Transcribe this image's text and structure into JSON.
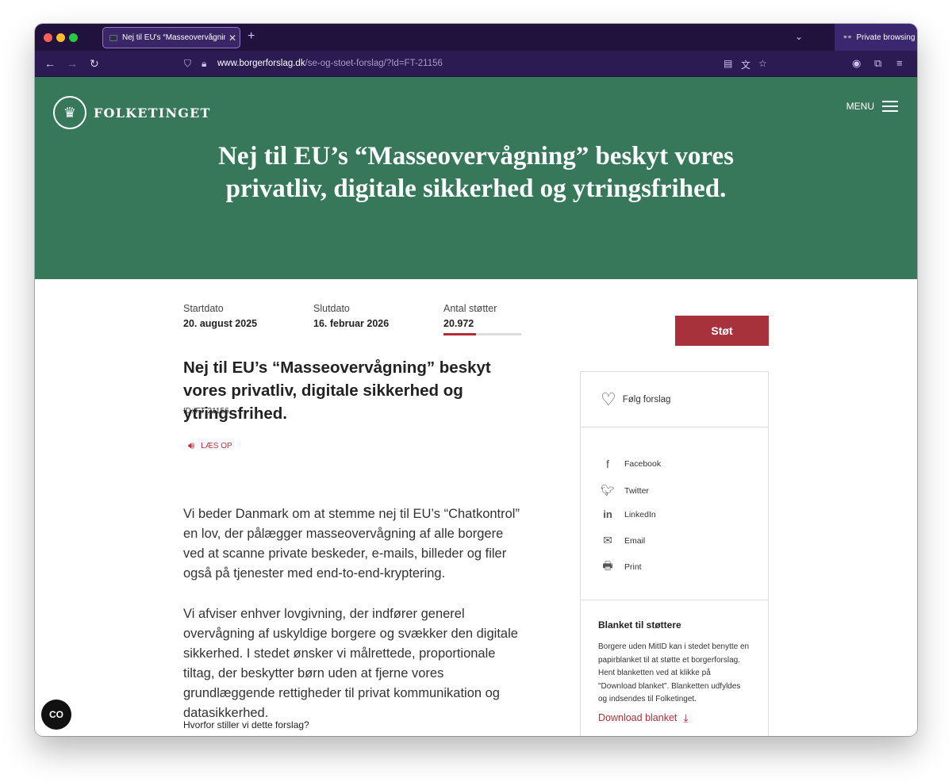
{
  "browser": {
    "tab_title": "Nej til EU's “Masseovervågning” beskyt vores privatliv",
    "tab_close": "✕",
    "new_tab": "+",
    "private_label": "Private browsing",
    "url_host": "www.borgerforslag.dk",
    "url_path": "/se-og-stoet-forslag/?Id=FT-21156"
  },
  "site": {
    "logo_text": "FOLKETINGET",
    "menu_label": "MENU"
  },
  "hero": {
    "title": "Nej til EU’s “Masseovervågning” beskyt vores privatliv, digitale sikkerhed og ytringsfrihed."
  },
  "meta": {
    "start_label": "Startdato",
    "start_value": "20. august 2025",
    "end_label": "Slutdato",
    "end_value": "16. februar 2026",
    "support_label": "Antal støtter",
    "support_value": "20.972",
    "support_progress": 0.42
  },
  "support_button": "Støt",
  "article": {
    "title": "Nej til EU’s “Masseovervågning” beskyt vores privatliv, digitale sikkerhed og ytringsfrihed.",
    "id": "ID: FT-21156",
    "read_aloud": "LÆS OP",
    "paragraph1": "Vi beder Danmark om at stemme nej til EU’s “Chatkontrol” en lov, der pålægger masseovervågning af alle borgere ved at scanne private beskeder, e-mails, billeder og filer også på tjenester med end-to-end-kryptering.",
    "paragraph2": "Vi afviser enhver lovgivning, der indfører generel overvågning af uskyldige borgere og svækker den digitale sikkerhed. I stedet ønsker vi målrettede, proportionale tiltag, der beskytter børn uden at fjerne vores grundlæggende rettigheder til privat kommunikation og datasikkerhed.",
    "why_heading": "Hvorfor stiller vi dette forslag?"
  },
  "sidebar": {
    "follow": "Følg forslag",
    "share": [
      {
        "label": "Facebook",
        "icon": "facebook-icon"
      },
      {
        "label": "Twitter",
        "icon": "twitter-icon"
      },
      {
        "label": "LinkedIn",
        "icon": "linkedin-icon"
      },
      {
        "label": "Email",
        "icon": "email-icon"
      },
      {
        "label": "Print",
        "icon": "print-icon"
      }
    ],
    "blanket_title": "Blanket til støttere",
    "blanket_text": "Borgere uden MitID kan i stedet benytte en papirblanket til at støtte et borgerforslag. Hent blanketten ved at klikke på \"Download blanket\". Blanketten udfyldes og indsendes til Folketinget.",
    "download": "Download blanket"
  },
  "floating_button": "CO"
}
